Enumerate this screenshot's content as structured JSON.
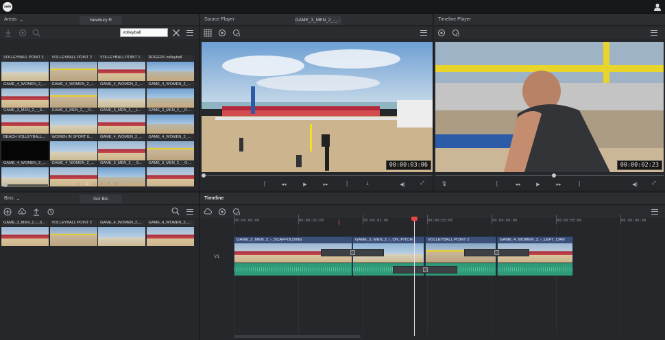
{
  "app": {
    "logo_text": "sam"
  },
  "areas": {
    "title": "Areas",
    "tab": "Newbury R",
    "search_value": "volleyball",
    "pagination": [
      "1",
      "2",
      "3",
      "4",
      "5"
    ],
    "thumbs": [
      {
        "label": "VOLLEYBALL POINT 3",
        "style": "sky"
      },
      {
        "label": "VOLLEYBALL POINT 2",
        "style": "yellowpost"
      },
      {
        "label": "VOLLEYBALL POINT 1",
        "style": "crowd"
      },
      {
        "label": "ROGERS volleyball",
        "style": "sky2"
      },
      {
        "label": "GAME_4_WOMEN_2_...",
        "style": "crowd"
      },
      {
        "label": "GAME_4_WOMEN_2_...",
        "style": "yellowpost"
      },
      {
        "label": "GAME_4_WOMEN_2_...",
        "style": "sky"
      },
      {
        "label": "GAME_4_WOMEN_2_...",
        "style": "sky2"
      },
      {
        "label": "GAME_3_MEN_2_-_S...",
        "style": "crowd"
      },
      {
        "label": "GAME_3_MEN_2_-_O...",
        "style": "sky"
      },
      {
        "label": "GAME_3_MEN_2_-_L...",
        "style": "crowd"
      },
      {
        "label": "GAME_3_MEN_2_-_R...",
        "style": "sky2"
      },
      {
        "label": "BEACH VOLLEYBALL...",
        "style": "black"
      },
      {
        "label": "WOMEN IN SPORT 8...",
        "style": "sky"
      },
      {
        "label": "GAME_4_WOMEN_2_...",
        "style": "crowd"
      },
      {
        "label": "GAME_4_WOMEN_2_...",
        "style": "yellowpost"
      },
      {
        "label": "GAME_4_WOMEN_2_...",
        "style": "sky"
      },
      {
        "label": "GAME_4_WOMEN_2_...",
        "style": "crowd"
      },
      {
        "label": "GAME_3_MEN_2_-_S...",
        "style": "sky2"
      },
      {
        "label": "GAME_3_MEN_2_-_O...",
        "style": "crowd"
      }
    ]
  },
  "bins": {
    "title": "Bins",
    "tab": "Go! Bin",
    "thumbs": [
      {
        "label": "GAME_3_MEN_2_-_S...",
        "style": "crowd"
      },
      {
        "label": "VOLLEYBALL POINT 2",
        "style": "yellowpost"
      },
      {
        "label": "GAME_4_WOMEN_2_...",
        "style": "sky"
      },
      {
        "label": "GAME_4_WOMEN_2_...",
        "style": "crowd"
      }
    ]
  },
  "source_player": {
    "title": "Source Player",
    "tab": "GAME_3_MEN_2_-_...",
    "timecode": "00:00:03:06",
    "progress": 0.01
  },
  "timeline_player": {
    "title": "Timeline Player",
    "timecode": "00:00:02:23",
    "progress": 0.52
  },
  "timeline": {
    "title": "Timeline",
    "track_label": "V1",
    "ruler": [
      "00:00:00:00",
      "00:00:01:00",
      "00:00:02:00",
      "00:00:03:00",
      "00:00:04:00",
      "00:00:05:00",
      "00:00:06:00"
    ],
    "clips": [
      {
        "label": "GAME_3_MEN_2_-_SCAFFOLDING",
        "style": "crowd"
      },
      {
        "label": "GAME_3_MEN_2_-_ON_PITCH",
        "style": "sky"
      },
      {
        "label": "VOLLEYBALL POINT 2",
        "style": "yellowpost"
      },
      {
        "label": "GAME_4_WOMEN_2_-_LEFT_CAM",
        "style": "crowd"
      }
    ]
  }
}
